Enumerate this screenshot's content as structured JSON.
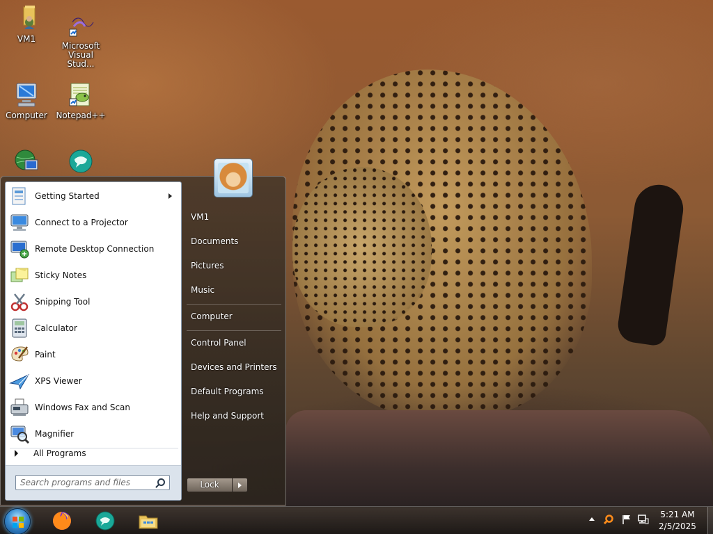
{
  "desktop": {
    "icons": [
      {
        "label": "VM1",
        "icon": "user-folder-icon"
      },
      {
        "label": "Microsoft Visual Stud...",
        "icon": "visual-studio-icon"
      },
      {
        "label": "Computer",
        "icon": "computer-icon"
      },
      {
        "label": "Notepad++",
        "icon": "notepad-plus-plus-icon"
      },
      {
        "label": "",
        "icon": "network-icon"
      },
      {
        "label": "",
        "icon": "chat-bubble-icon"
      }
    ]
  },
  "start_menu": {
    "programs": [
      {
        "label": "Getting Started",
        "icon": "getting-started-icon",
        "has_submenu": true
      },
      {
        "label": "Connect to a Projector",
        "icon": "projector-icon"
      },
      {
        "label": "Remote Desktop Connection",
        "icon": "remote-desktop-icon"
      },
      {
        "label": "Sticky Notes",
        "icon": "sticky-notes-icon"
      },
      {
        "label": "Snipping Tool",
        "icon": "snipping-tool-icon"
      },
      {
        "label": "Calculator",
        "icon": "calculator-icon"
      },
      {
        "label": "Paint",
        "icon": "paint-icon"
      },
      {
        "label": "XPS Viewer",
        "icon": "xps-viewer-icon"
      },
      {
        "label": "Windows Fax and Scan",
        "icon": "fax-scan-icon"
      },
      {
        "label": "Magnifier",
        "icon": "magnifier-icon"
      }
    ],
    "all_programs": "All Programs",
    "search_placeholder": "Search programs and files",
    "right_items": [
      {
        "label": "VM1"
      },
      {
        "label": "Documents"
      },
      {
        "label": "Pictures"
      },
      {
        "label": "Music"
      },
      {
        "label": "Computer"
      },
      {
        "label": "Control Panel"
      },
      {
        "label": "Devices and Printers"
      },
      {
        "label": "Default Programs"
      },
      {
        "label": "Help and Support"
      }
    ],
    "lock_label": "Lock",
    "user_picture_icon": "user-picture-dog-icon"
  },
  "taskbar": {
    "apps": [
      {
        "icon": "firefox-icon"
      },
      {
        "icon": "chat-bubble-icon"
      },
      {
        "icon": "file-explorer-icon"
      }
    ],
    "clock_time": "5:21 AM",
    "clock_date": "2/5/2025"
  },
  "colors": {
    "taskbar": "#2a2420",
    "start_orb": "#3a8cd0",
    "left_pane": "#ffffff",
    "search_area": "#dbe3ec"
  }
}
